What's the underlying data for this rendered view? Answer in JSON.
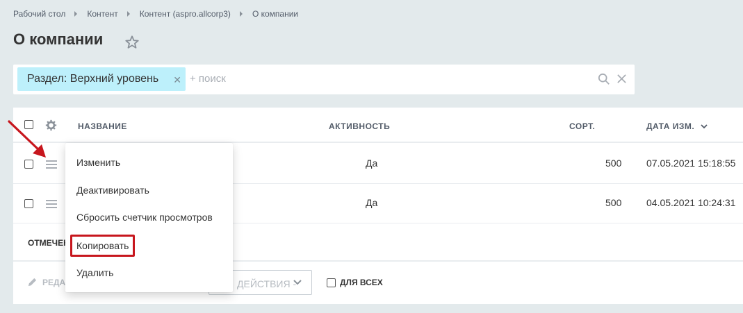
{
  "breadcrumb": [
    "Рабочий стол",
    "Контент",
    "Контент (aspro.allcorp3)",
    "О компании"
  ],
  "page_title": "О компании",
  "filter": {
    "tag_label": "Раздел: Верхний уровень",
    "search_placeholder": "+ поиск"
  },
  "grid": {
    "columns": {
      "name": "НАЗВАНИЕ",
      "active": "АКТИВНОСТЬ",
      "sort": "СОРТ.",
      "date": "ДАТА ИЗМ."
    },
    "rows": [
      {
        "active": "Да",
        "sort": "500",
        "date": "07.05.2021 15:18:55"
      },
      {
        "active": "Да",
        "sort": "500",
        "date": "04.05.2021 10:24:31"
      }
    ],
    "footer_label": "ОТМЕЧЕН",
    "edit_label": "РЕДА",
    "actions_placeholder": "ДЕЙСТВИЯ -",
    "for_all_label": "ДЛЯ ВСЕХ"
  },
  "context_menu": {
    "items": [
      "Изменить",
      "Деактивировать",
      "Сбросить счетчик просмотров",
      "Копировать",
      "Удалить"
    ],
    "highlighted": "Копировать"
  },
  "colors": {
    "background": "#e3eaec",
    "tag_bg": "#bdf0fb",
    "highlight": "#c7161d"
  }
}
